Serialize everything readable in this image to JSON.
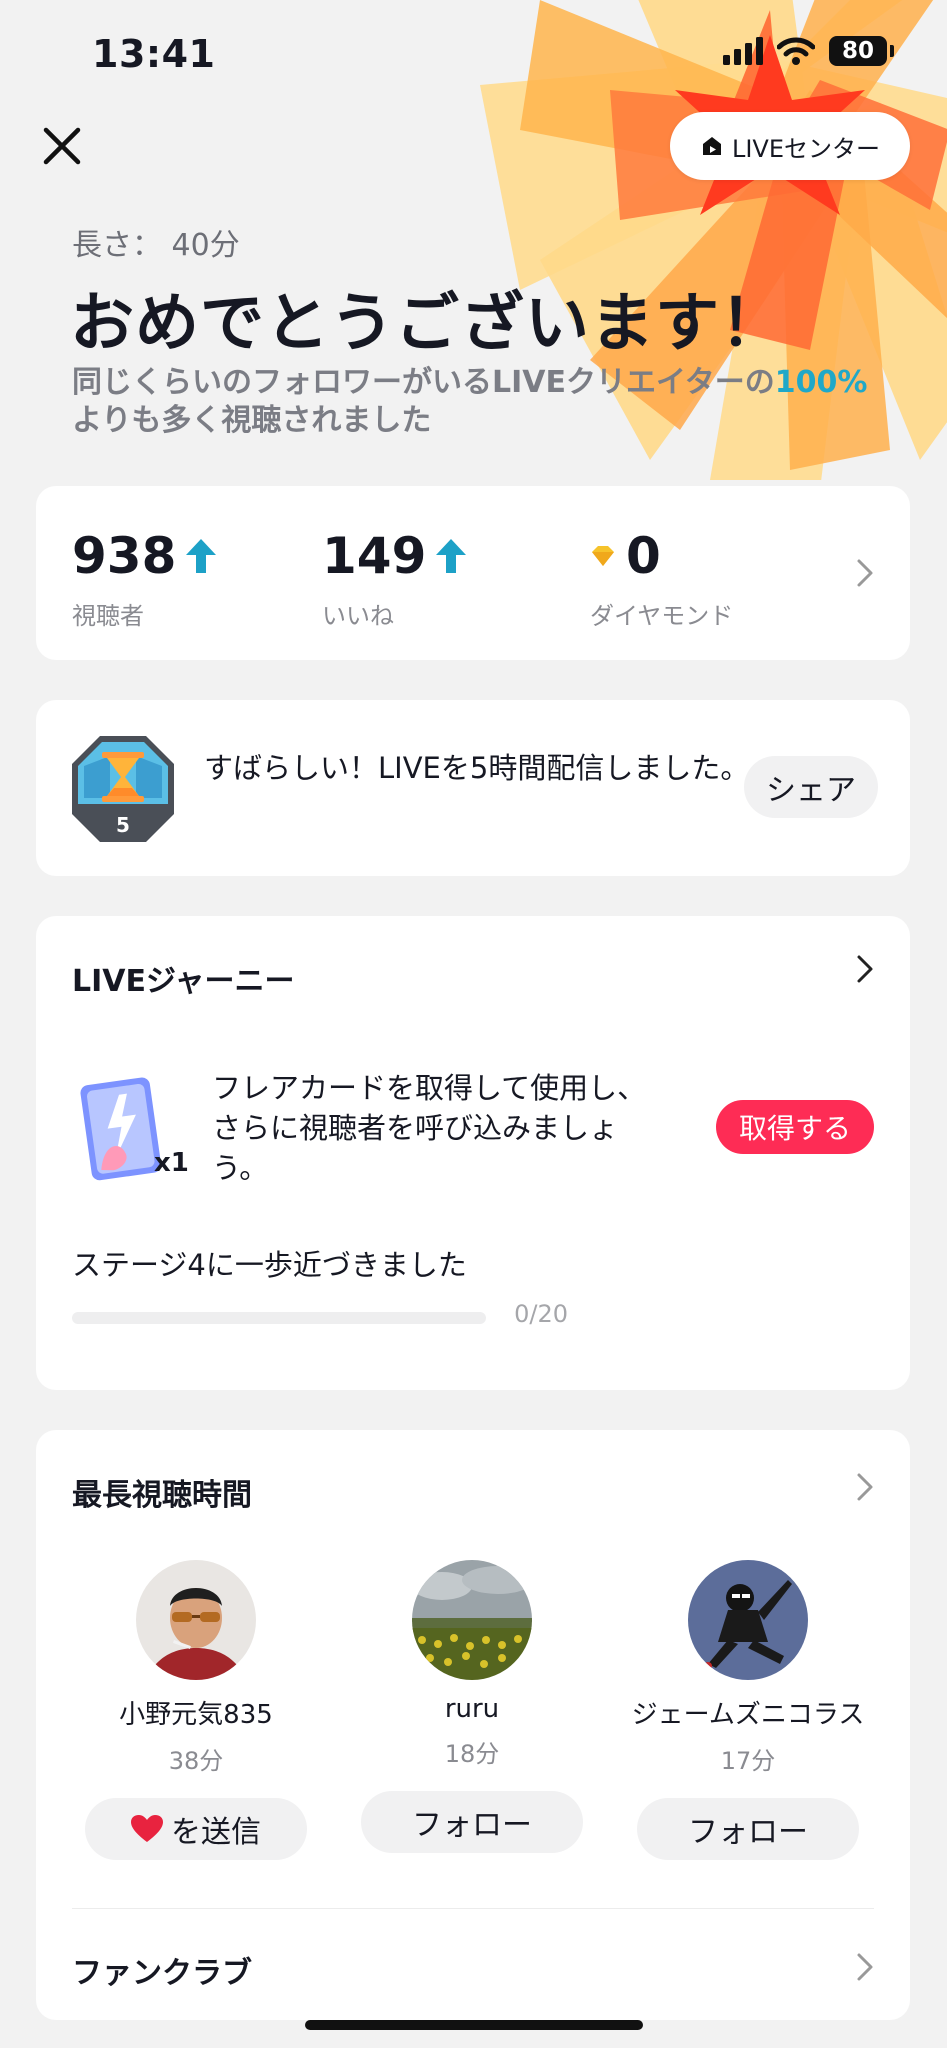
{
  "colors": {
    "accent": "#fe2c55",
    "highlight": "#20a8c8",
    "arrow": "#1da1c7"
  },
  "status_bar": {
    "time": "13:41",
    "battery": "80"
  },
  "header": {
    "live_center_label": "LIVEセンター",
    "duration": "長さ： 40分",
    "headline": "おめでとうございます！",
    "subtitle_prefix": "同じくらいのフォロワーがいるLIVEクリエイターの",
    "subtitle_percent": "100%",
    "subtitle_suffix": "よりも多く視聴されました"
  },
  "stats": [
    {
      "value": "938",
      "label": "視聴者",
      "trend": "up"
    },
    {
      "value": "149",
      "label": "いいね",
      "trend": "up"
    },
    {
      "value": "0",
      "label": "ダイヤモンド",
      "icon": "diamond-icon"
    }
  ],
  "badge": {
    "level": "5",
    "text": "すばらしい！LIVEを5時間配信しました。",
    "share_label": "シェア"
  },
  "journey": {
    "title": "LIVEジャーニー",
    "card_count": "x1",
    "description": "フレアカードを取得して使用し、さらに視聴者を呼び込みましょう。",
    "get_label": "取得する",
    "stage_text": "ステージ4に一歩近づきました",
    "progress_label": "0/20",
    "progress_value": 0
  },
  "top_viewers": {
    "title": "最長視聴時間",
    "viewers": [
      {
        "name": "小野元気835",
        "time": "38分",
        "action_label": "を送信",
        "action_icon": "heart-icon"
      },
      {
        "name": "ruru",
        "time": "18分",
        "action_label": "フォロー"
      },
      {
        "name": "ジェームズニコラス",
        "time": "17分",
        "action_label": "フォロー"
      }
    ]
  },
  "fanclub": {
    "label": "ファンクラブ"
  }
}
